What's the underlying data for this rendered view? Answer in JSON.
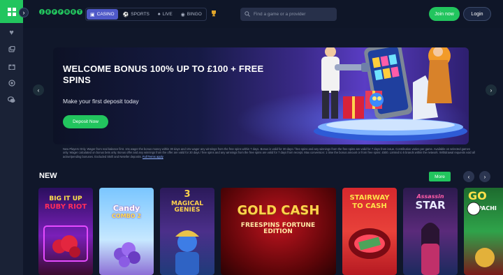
{
  "nav": {
    "tabs": [
      {
        "label": "CASINO",
        "icon": "casino-icon",
        "active": true
      },
      {
        "label": "SPORTS",
        "icon": "football-icon"
      },
      {
        "label": "LIVE",
        "icon": "live-icon"
      },
      {
        "label": "BINGO",
        "icon": "bingo-icon"
      }
    ]
  },
  "logo": {
    "text": "JEFFBET"
  },
  "search": {
    "placeholder": "Find a game or a provider"
  },
  "auth": {
    "join_label": "Join now",
    "login_label": "Login"
  },
  "hero": {
    "title": "WELCOME BONUS 100% UP TO £100 + FREE SPINS",
    "subtitle": "Make your first deposit today",
    "cta_label": "Deposit Now"
  },
  "terms": {
    "text": "New Players Only. Wager from real balance first. 10x wager the bonus money within 30 days and 10x wager any winnings from the free spins within 7 days. Bonus is valid for 30 days / free spins and any winnings from the free spins are valid for 7 days from issue. Contribution varies per game. Available on selected games only. Wager calculated on bonus bets only. Bonus offer and any winnings from the offer are valid for 30 days / free spins and any winnings from the free spins are valid for 7 days from receipt. Max conversion: 1 time the bonus amount or from free spins: £500. Limited to 5 brands within the network. Withdrawal requests void all active/pending bonuses. Excluded Skrill and Neteller deposits.",
    "link_label": "Full Terms apply"
  },
  "new_section": {
    "title": "NEW",
    "more_label": "More",
    "games": [
      {
        "line1": "BIG IT UP",
        "line2": "RUBY RIOT"
      },
      {
        "line1": "Candy",
        "line2": "COMBO 2"
      },
      {
        "line1": "3",
        "line2": "MAGICAL GENIES"
      },
      {
        "line1": "GOLD CASH",
        "line2": "FREESPINS FORTUNE EDITION"
      },
      {
        "line1": "STAIRWAY",
        "line2": "TO CASH"
      },
      {
        "line1": "Assassin",
        "line2": "STAR"
      },
      {
        "line1": "GO",
        "line2": "PACHI"
      }
    ]
  }
}
